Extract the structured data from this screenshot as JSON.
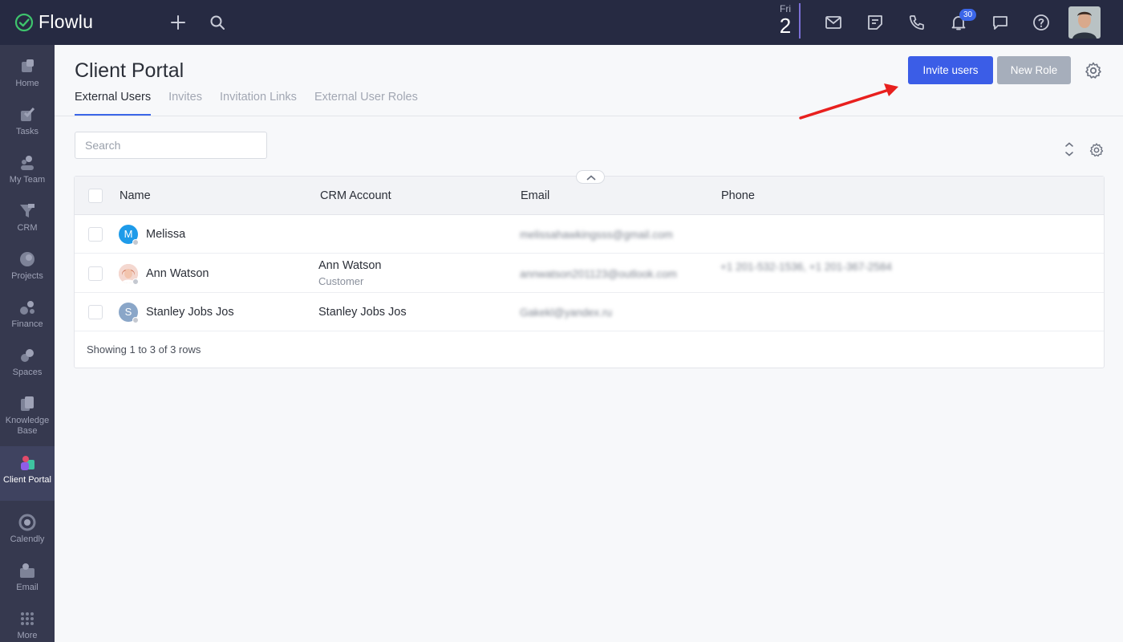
{
  "app": {
    "name": "Flowlu"
  },
  "topbar": {
    "date_day": "Fri",
    "date_num": "2",
    "notification_count": "30"
  },
  "sidebar": {
    "items": [
      {
        "label": "Home",
        "icon": "home-icon"
      },
      {
        "label": "Tasks",
        "icon": "tasks-icon"
      },
      {
        "label": "My Team",
        "icon": "team-icon"
      },
      {
        "label": "CRM",
        "icon": "crm-icon"
      },
      {
        "label": "Projects",
        "icon": "projects-icon"
      },
      {
        "label": "Finance",
        "icon": "finance-icon"
      },
      {
        "label": "Spaces",
        "icon": "spaces-icon"
      },
      {
        "label": "Knowledge Base",
        "icon": "knowledge-base-icon"
      },
      {
        "label": "Client Portal",
        "icon": "client-portal-icon",
        "active": true
      },
      {
        "label": "Calendly",
        "icon": "calendly-icon"
      },
      {
        "label": "Email",
        "icon": "email-icon"
      },
      {
        "label": "More",
        "icon": "more-grid-icon"
      }
    ]
  },
  "page": {
    "title": "Client Portal",
    "tabs": [
      {
        "label": "External Users",
        "active": true
      },
      {
        "label": "Invites"
      },
      {
        "label": "Invitation Links"
      },
      {
        "label": "External User Roles"
      }
    ],
    "invite_button": "Invite users",
    "new_role_button": "New Role"
  },
  "search": {
    "placeholder": "Search",
    "value": ""
  },
  "table": {
    "columns": [
      "Name",
      "CRM Account",
      "Email",
      "Phone"
    ],
    "rows": [
      {
        "avatar_letter": "M",
        "avatar_color": "#1e9be9",
        "name": "Melissa",
        "crm_account": "",
        "crm_sub": "",
        "email": "melissahawkingsss@gmail.com",
        "phone": ""
      },
      {
        "avatar_letter": "",
        "avatar_color": "#f0b8b0",
        "name": "Ann Watson",
        "crm_account": "Ann Watson",
        "crm_sub": "Customer",
        "email": "annwatson201123@outlook.com",
        "phone": "+1 201-532-1536, +1 201-367-2584"
      },
      {
        "avatar_letter": "S",
        "avatar_color": "#8aa6c8",
        "name": "Stanley Jobs Jos",
        "crm_account": "Stanley Jobs Jos",
        "crm_sub": "",
        "email": "Gakekl@yandex.ru",
        "phone": ""
      }
    ],
    "footer": "Showing 1 to 3 of 3 rows"
  },
  "colors": {
    "topbar": "#262a42",
    "sidebar": "#36394f",
    "primary": "#3b5de7",
    "annotation_arrow": "#e8201e"
  }
}
